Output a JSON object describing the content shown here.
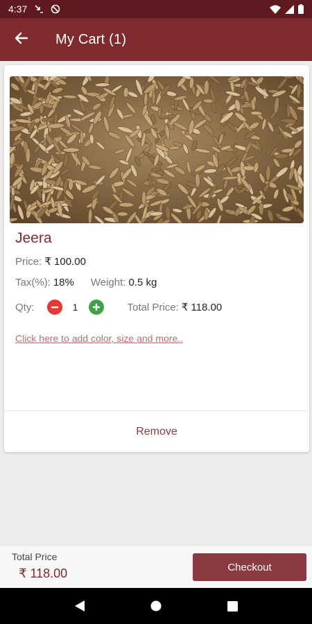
{
  "status_bar": {
    "time": "4:37",
    "icons": [
      "missed-call-icon",
      "sync-off-icon",
      "wifi-icon",
      "cellular-signal-icon",
      "battery-icon"
    ]
  },
  "app_bar": {
    "title": "My Cart (1)",
    "back_icon": "arrow-left-icon",
    "color": "#7e2a2e"
  },
  "cart": {
    "items": [
      {
        "name": "Jeera",
        "image": "cumin-seeds-photo",
        "price_label": "Price:",
        "price_value": "₹ 100.00",
        "tax_label": "Tax(%):",
        "tax_value": "18%",
        "weight_label": "Weight:",
        "weight_value": "0.5 kg",
        "qty_label": "Qty:",
        "qty_value": "1",
        "total_label": "Total Price:",
        "total_value": "₹ 118.00",
        "customize_link": "Click here to add color, size and more..",
        "remove_label": "Remove"
      }
    ]
  },
  "footer": {
    "total_caption": "Total Price",
    "total_amount": "₹ 118.00",
    "checkout_label": "Checkout"
  },
  "nav_bar": {
    "buttons": [
      "back-triangle-icon",
      "home-circle-icon",
      "recents-square-icon"
    ]
  },
  "colors": {
    "primary": "#7e2a2e",
    "status_bar": "#5e1a1e",
    "minus": "#e53935",
    "plus": "#43a047",
    "link": "#c06a72"
  }
}
